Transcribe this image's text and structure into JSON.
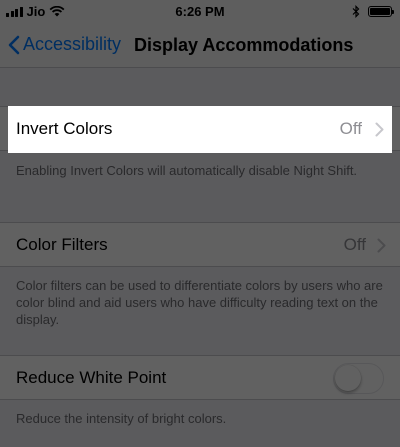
{
  "status": {
    "carrier": "Jio",
    "time": "6:26 PM"
  },
  "nav": {
    "back_label": "Accessibility",
    "title": "Display Accommodations"
  },
  "invert_colors": {
    "label": "Invert Colors",
    "value": "Off",
    "footer": "Enabling Invert Colors will automatically disable Night Shift."
  },
  "color_filters": {
    "label": "Color Filters",
    "value": "Off",
    "footer": "Color filters can be used to differentiate colors by users who are color blind and aid users who have difficulty reading text on the display."
  },
  "reduce_white_point": {
    "label": "Reduce White Point",
    "enabled": false,
    "footer": "Reduce the intensity of bright colors."
  },
  "colors": {
    "accent": "#007aff",
    "background": "#efeff4",
    "secondary_text": "#8e8e93"
  },
  "icons": [
    "signal-icon",
    "wifi-icon",
    "bluetooth-icon",
    "battery-icon",
    "back-chevron-icon",
    "chevron-right-icon"
  ]
}
